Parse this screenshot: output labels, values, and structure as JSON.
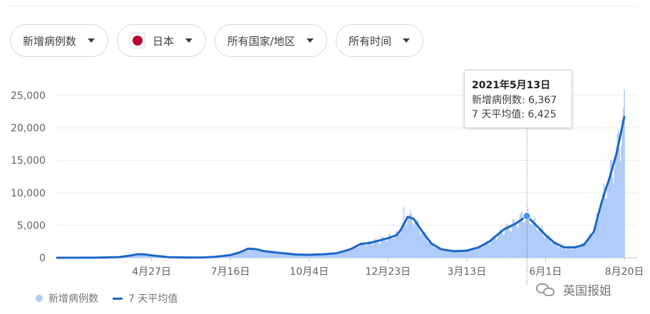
{
  "filters": {
    "metric": "新增病例数",
    "country": "日本",
    "region": "所有国家/地区",
    "period": "所有时间"
  },
  "tooltip": {
    "date": "2021年5月13日",
    "cases_label": "新增病例数",
    "cases_value": "6,367",
    "avg_label": "7 天平均值",
    "avg_value": "6,425"
  },
  "legend": {
    "bars": "新增病例数",
    "line": "7 天平均值"
  },
  "watermark": "英国报姐",
  "colors": {
    "bars": "#aecbfa",
    "line": "#1a66c8",
    "flag": "#bc002d"
  },
  "chart_data": {
    "type": "bar",
    "title": "",
    "xlabel": "",
    "ylabel": "",
    "ylim": [
      0,
      25000
    ],
    "grid": true,
    "legend_position": "bottom-left",
    "y_ticks": [
      0,
      5000,
      10000,
      15000,
      20000,
      25000
    ],
    "y_tick_labels": [
      "0",
      "5,000",
      "10,000",
      "15,000",
      "20,000",
      "25,000"
    ],
    "x_tick_labels": [
      "4月27日",
      "7月16日",
      "10月4日",
      "12月23日",
      "3月13日",
      "6月1日",
      "8月20日"
    ],
    "x_tick_dates": [
      "2020-04-27",
      "2020-07-16",
      "2020-10-04",
      "2020-12-23",
      "2021-03-13",
      "2021-06-01",
      "2021-08-20"
    ],
    "date_range": [
      "2020-01-22",
      "2021-08-20"
    ],
    "highlight": {
      "date": "2021-05-13",
      "cases": 6367,
      "seven_day_avg": 6425
    },
    "series": [
      {
        "name": "7 天平均值",
        "kind": "line",
        "points": [
          [
            "2020-01-22",
            0
          ],
          [
            "2020-03-01",
            15
          ],
          [
            "2020-03-25",
            100
          ],
          [
            "2020-04-05",
            330
          ],
          [
            "2020-04-13",
            550
          ],
          [
            "2020-04-20",
            520
          ],
          [
            "2020-05-01",
            300
          ],
          [
            "2020-05-15",
            80
          ],
          [
            "2020-06-01",
            40
          ],
          [
            "2020-06-20",
            60
          ],
          [
            "2020-07-01",
            150
          ],
          [
            "2020-07-16",
            420
          ],
          [
            "2020-07-25",
            800
          ],
          [
            "2020-08-03",
            1400
          ],
          [
            "2020-08-10",
            1350
          ],
          [
            "2020-08-20",
            1000
          ],
          [
            "2020-09-01",
            800
          ],
          [
            "2020-09-20",
            500
          ],
          [
            "2020-10-04",
            450
          ],
          [
            "2020-10-20",
            550
          ],
          [
            "2020-11-01",
            700
          ],
          [
            "2020-11-15",
            1300
          ],
          [
            "2020-11-25",
            2100
          ],
          [
            "2020-12-05",
            2300
          ],
          [
            "2020-12-23",
            3000
          ],
          [
            "2021-01-01",
            3500
          ],
          [
            "2021-01-05",
            4300
          ],
          [
            "2021-01-12",
            6300
          ],
          [
            "2021-01-18",
            6000
          ],
          [
            "2021-01-28",
            3800
          ],
          [
            "2021-02-05",
            2200
          ],
          [
            "2021-02-15",
            1300
          ],
          [
            "2021-02-28",
            1000
          ],
          [
            "2021-03-13",
            1100
          ],
          [
            "2021-03-25",
            1600
          ],
          [
            "2021-04-05",
            2500
          ],
          [
            "2021-04-20",
            4400
          ],
          [
            "2021-05-01",
            5200
          ],
          [
            "2021-05-13",
            6425
          ],
          [
            "2021-05-25",
            4600
          ],
          [
            "2021-06-01",
            3500
          ],
          [
            "2021-06-10",
            2300
          ],
          [
            "2021-06-20",
            1600
          ],
          [
            "2021-07-01",
            1600
          ],
          [
            "2021-07-10",
            2000
          ],
          [
            "2021-07-20",
            4000
          ],
          [
            "2021-07-28",
            8600
          ],
          [
            "2021-08-05",
            12300
          ],
          [
            "2021-08-12",
            16000
          ],
          [
            "2021-08-20",
            21700
          ]
        ]
      },
      {
        "name": "新增病例数",
        "kind": "bar",
        "note_values": "daily cases roughly follow the 7 天平均值 curve with weekly oscillation; peaks ≈7,800 (2021-01-08) and ≈25,900 (2021-08-20)",
        "points": [
          [
            "2021-01-08",
            7800
          ],
          [
            "2021-05-08",
            7200
          ],
          [
            "2021-05-13",
            6367
          ],
          [
            "2021-08-20",
            25900
          ]
        ]
      }
    ]
  }
}
